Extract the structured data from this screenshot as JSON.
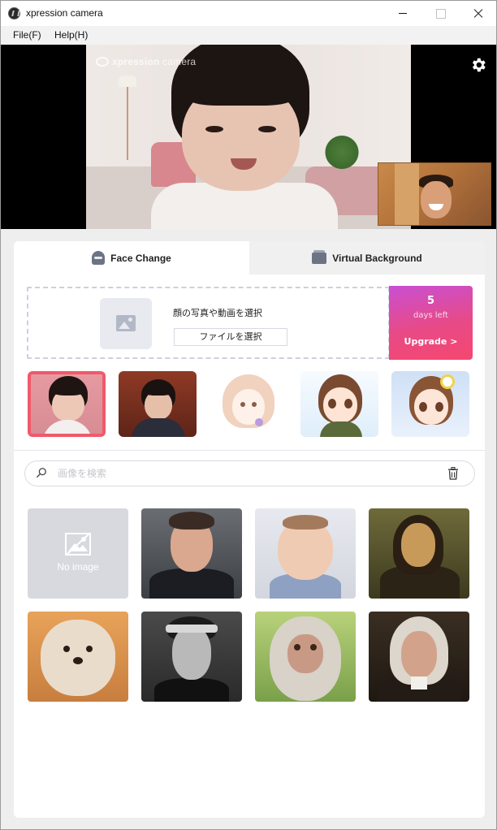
{
  "window": {
    "title": "xpression camera"
  },
  "menu": {
    "items": [
      "File(F)",
      "Help(H)"
    ]
  },
  "video": {
    "watermark_brand": "xpression",
    "watermark_suffix": "camera"
  },
  "tabs": {
    "face_change": "Face Change",
    "virtual_background": "Virtual Background"
  },
  "upload": {
    "prompt": "顔の写真や動画を選択",
    "file_button": "ファイルを選択"
  },
  "upgrade": {
    "days": "5",
    "days_left": "days left",
    "label": "Upgrade >"
  },
  "search": {
    "placeholder": "画像を検索",
    "value": ""
  },
  "gallery": {
    "no_image_label": "No image"
  },
  "colors": {
    "selected_border": "#ef5a6c",
    "upgrade_gradient_start": "#c94fd2",
    "upgrade_gradient_end": "#f54770"
  },
  "icons": [
    "app-icon",
    "gear-icon",
    "face-icon",
    "background-icon",
    "picture-icon",
    "search-icon",
    "trash-icon",
    "no-image-icon"
  ]
}
